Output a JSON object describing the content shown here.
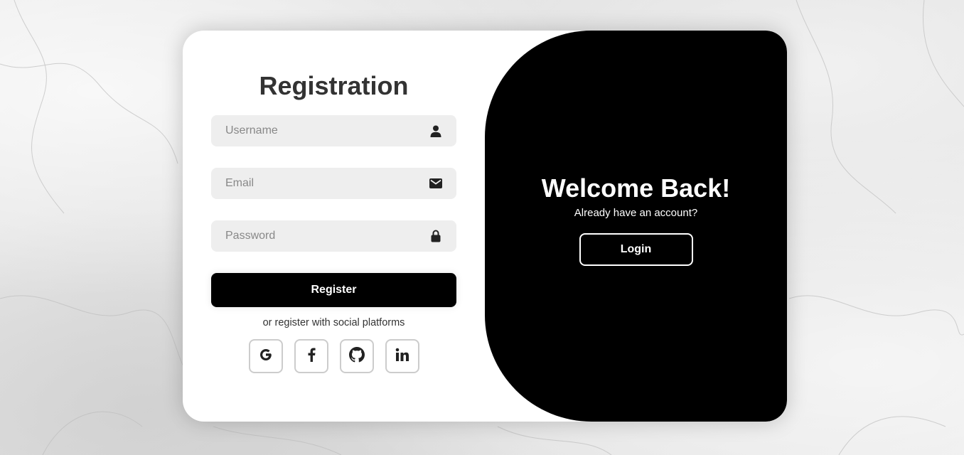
{
  "registration": {
    "title": "Registration",
    "fields": {
      "username": {
        "placeholder": "Username",
        "value": "",
        "icon": "user-icon"
      },
      "email": {
        "placeholder": "Email",
        "value": "",
        "icon": "envelope-icon"
      },
      "password": {
        "placeholder": "Password",
        "value": "",
        "icon": "lock-icon"
      }
    },
    "register_label": "Register",
    "social_text": "or register with social platforms",
    "social": [
      "google-icon",
      "facebook-icon",
      "github-icon",
      "linkedin-icon"
    ]
  },
  "toggle": {
    "title": "Welcome Back!",
    "subtitle": "Already have an account?",
    "login_label": "Login"
  },
  "colors": {
    "panel": "#000000",
    "input_bg": "#eeeeee",
    "text": "#333333"
  }
}
